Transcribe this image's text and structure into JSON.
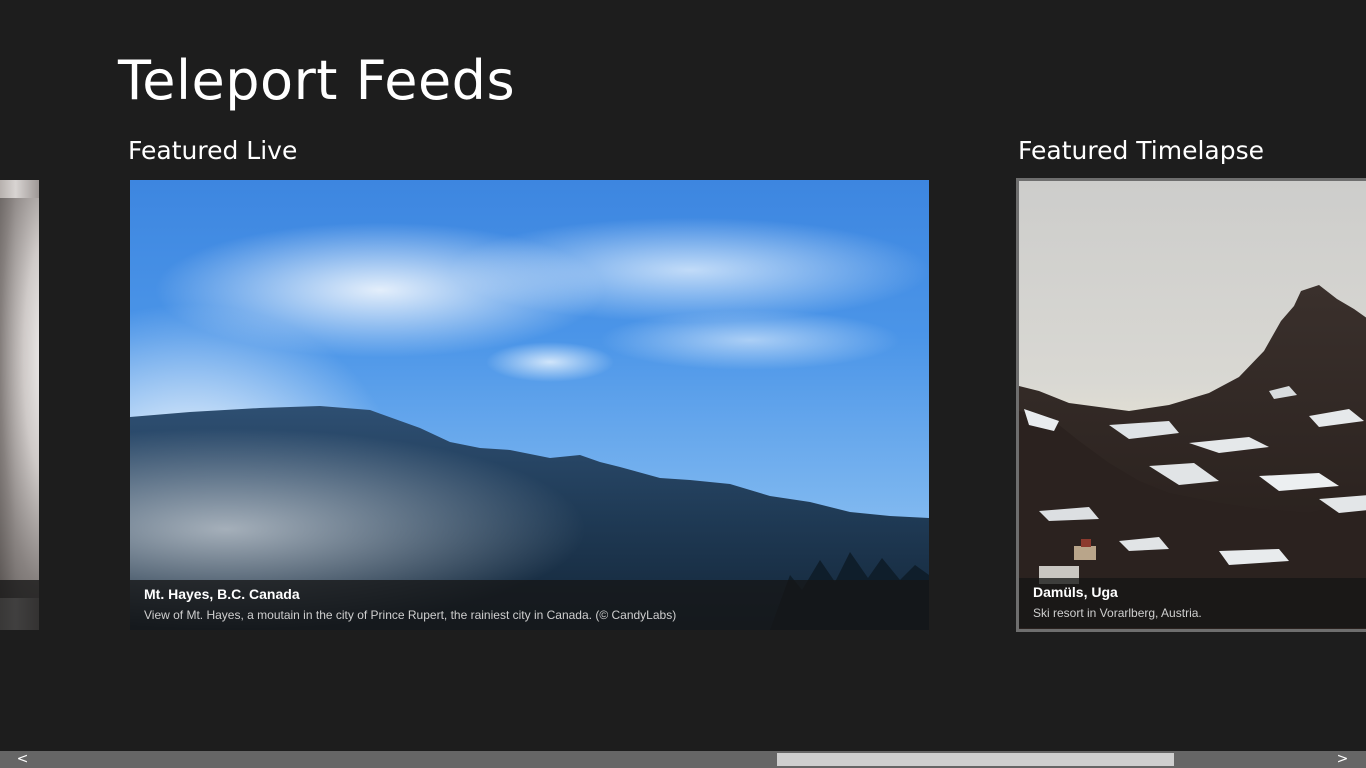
{
  "app": {
    "title": "Teleport Feeds"
  },
  "sections": {
    "live": {
      "header": "Featured Live",
      "tile": {
        "title": "Mt. Hayes, B.C. Canada",
        "description": "View of Mt. Hayes, a moutain in the city of Prince Rupert, the rainiest city in Canada. (© CandyLabs)"
      }
    },
    "timelapse": {
      "header": "Featured Timelapse",
      "tile": {
        "title": "Damüls, Uga",
        "description": "Ski resort in Vorarlberg, Austria."
      }
    }
  },
  "scrollbar": {
    "left_arrow": "<",
    "right_arrow": ">"
  },
  "colors": {
    "background": "#1d1d1d",
    "scrollbar_track": "#666666",
    "scrollbar_thumb": "#cfcfcf"
  }
}
